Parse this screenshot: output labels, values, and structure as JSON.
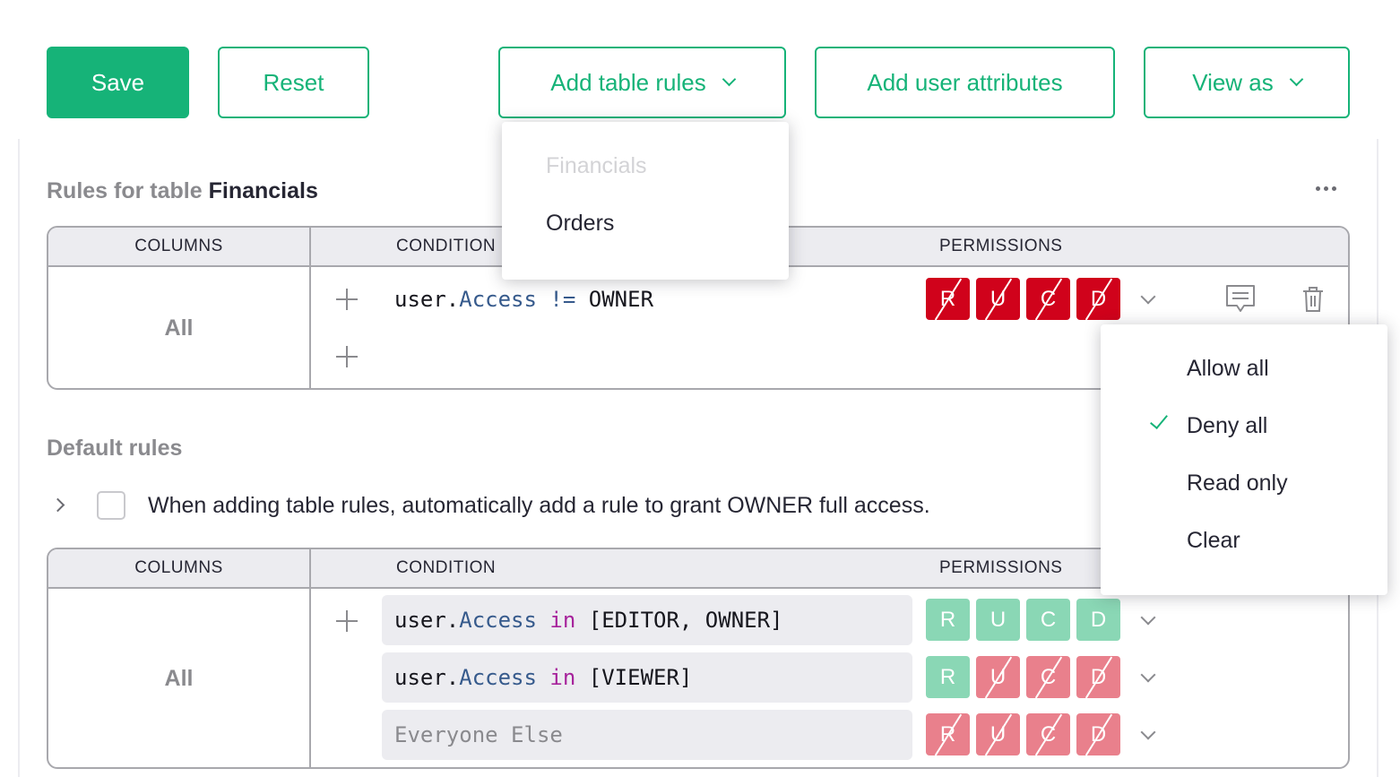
{
  "toolbar": {
    "save_label": "Save",
    "reset_label": "Reset",
    "add_table_rules_label": "Add table rules",
    "add_user_attributes_label": "Add user attributes",
    "view_as_label": "View as"
  },
  "colors": {
    "accent": "#16b378",
    "deny": "#d0021b",
    "allow_light": "#8ad7b5",
    "deny_light": "#e9808c"
  },
  "table_rules_dropdown": {
    "items": [
      {
        "label": "Financials",
        "disabled": true
      },
      {
        "label": "Orders",
        "disabled": false
      }
    ]
  },
  "table_section": {
    "title_prefix": "Rules for table",
    "table_name": "Financials",
    "headers": {
      "columns": "COLUMNS",
      "condition": "CONDITION",
      "permissions": "PERMISSIONS"
    },
    "columns_value": "All",
    "rule": {
      "prefix": "user.",
      "attr": "Access",
      "op": "!=",
      "value": "OWNER",
      "permissions": [
        {
          "letter": "R",
          "state": "deny"
        },
        {
          "letter": "U",
          "state": "deny"
        },
        {
          "letter": "C",
          "state": "deny"
        },
        {
          "letter": "D",
          "state": "deny"
        }
      ]
    }
  },
  "permissions_menu": {
    "items": [
      {
        "label": "Allow all",
        "checked": false
      },
      {
        "label": "Deny all",
        "checked": true
      },
      {
        "label": "Read only",
        "checked": false
      },
      {
        "label": "Clear",
        "checked": false
      }
    ]
  },
  "default_section": {
    "title": "Default rules",
    "owner_checkbox_label": "When adding table rules, automatically add a rule to grant OWNER full access.",
    "owner_checkbox_checked": false,
    "headers": {
      "columns": "COLUMNS",
      "condition": "CONDITION",
      "permissions": "PERMISSIONS"
    },
    "columns_value": "All",
    "rules": [
      {
        "prefix": "user.",
        "attr": "Access",
        "op": "in",
        "value": "[EDITOR, OWNER]",
        "permissions": [
          {
            "letter": "R",
            "state": "allow"
          },
          {
            "letter": "U",
            "state": "allow"
          },
          {
            "letter": "C",
            "state": "allow"
          },
          {
            "letter": "D",
            "state": "allow"
          }
        ]
      },
      {
        "prefix": "user.",
        "attr": "Access",
        "op": "in",
        "value": "[VIEWER]",
        "permissions": [
          {
            "letter": "R",
            "state": "allow"
          },
          {
            "letter": "U",
            "state": "deny"
          },
          {
            "letter": "C",
            "state": "deny"
          },
          {
            "letter": "D",
            "state": "deny"
          }
        ]
      }
    ],
    "fallback": {
      "placeholder": "Everyone Else",
      "permissions": [
        {
          "letter": "R",
          "state": "deny"
        },
        {
          "letter": "U",
          "state": "deny"
        },
        {
          "letter": "C",
          "state": "deny"
        },
        {
          "letter": "D",
          "state": "deny"
        }
      ]
    }
  }
}
